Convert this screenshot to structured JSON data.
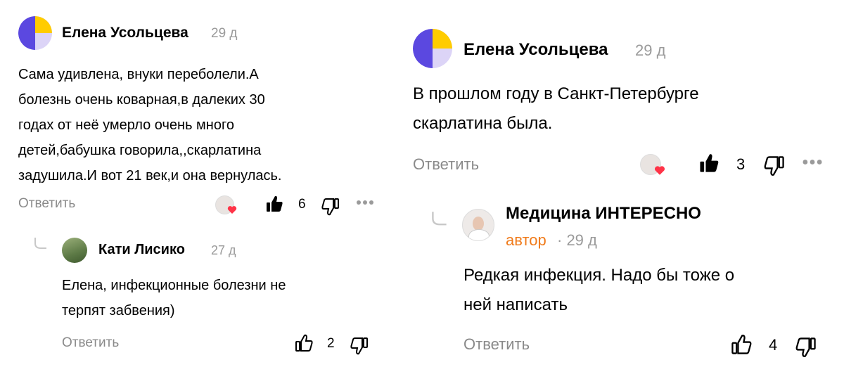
{
  "left_comment": {
    "author": "Елена Усольцева",
    "time": "29 д",
    "lines": [
      "Сама удивлена, внуки переболели.А",
      "болезнь очень коварная,в далеких 30",
      "годах от неё умерло очень много",
      "детей,бабушка говорила,,скарлатина",
      "задушила.И вот 21 век,и она вернулась."
    ],
    "reply_label": "Ответить",
    "likes": "6"
  },
  "left_reply": {
    "author": "Кати Лисико",
    "time": "27 д",
    "lines": [
      "Елена, инфекционные болезни не",
      "терпят забвения)"
    ],
    "reply_label": "Ответить",
    "likes": "2"
  },
  "right_comment": {
    "author": "Елена Усольцева",
    "time": "29 д",
    "lines": [
      "В прошлом году в Санкт-Петербурге",
      "скарлатина была."
    ],
    "reply_label": "Ответить",
    "likes": "3"
  },
  "right_reply": {
    "author": "Медицина ИНТЕРЕСНО",
    "author_badge": "автор",
    "time": "· 29 д",
    "lines": [
      "Редкая инфекция. Надо бы тоже о",
      "ней написать"
    ],
    "reply_label": "Ответить",
    "likes": "4"
  },
  "colors": {
    "badge": "#f07b1b",
    "heart": "#ff3347",
    "avatar_purple": "#5b48e0",
    "avatar_yellow": "#ffcc00",
    "avatar_lilac": "#dcd4f7"
  },
  "icons": [
    "yandex-avatar-icon",
    "like-icon",
    "dislike-icon",
    "more-icon",
    "heart-icon",
    "reply-branch-icon"
  ]
}
